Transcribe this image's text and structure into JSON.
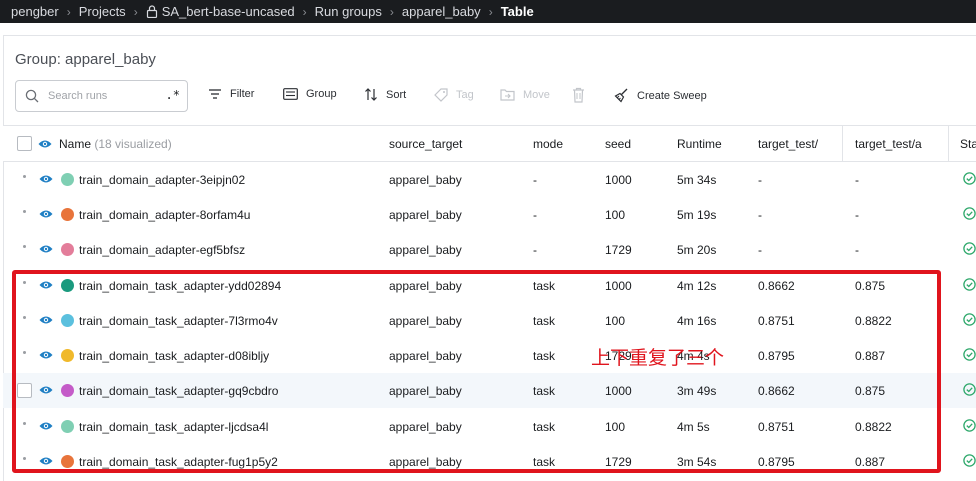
{
  "breadcrumb": {
    "user": "pengber",
    "projects": "Projects",
    "project": "SA_bert-base-uncased",
    "run_groups": "Run groups",
    "group": "apparel_baby",
    "view": "Table"
  },
  "group_title": "Group: apparel_baby",
  "search": {
    "placeholder": "Search runs",
    "regex_label": ".*"
  },
  "toolbar": {
    "filter": "Filter",
    "group": "Group",
    "sort": "Sort",
    "tag": "Tag",
    "move": "Move",
    "create_sweep": "Create Sweep"
  },
  "table": {
    "headers": {
      "name": "Name",
      "name_note": "(18 visualized)",
      "source_target": "source_target",
      "mode": "mode",
      "seed": "seed",
      "runtime": "Runtime",
      "target_test_1": "target_test/",
      "target_test_2": "target_test/a",
      "state": "Sta"
    },
    "rows": [
      {
        "name": "train_domain_adapter-3eipjn02",
        "color": "#7fcfb3",
        "source_target": "apparel_baby",
        "mode": "-",
        "seed": "1000",
        "runtime": "5m 34s",
        "t1": "-",
        "t2": "-"
      },
      {
        "name": "train_domain_adapter-8orfam4u",
        "color": "#e8743b",
        "source_target": "apparel_baby",
        "mode": "-",
        "seed": "100",
        "runtime": "5m 19s",
        "t1": "-",
        "t2": "-"
      },
      {
        "name": "train_domain_adapter-egf5bfsz",
        "color": "#e37d9a",
        "source_target": "apparel_baby",
        "mode": "-",
        "seed": "1729",
        "runtime": "5m 20s",
        "t1": "-",
        "t2": "-"
      },
      {
        "name": "train_domain_task_adapter-ydd02894",
        "color": "#1a9a7e",
        "source_target": "apparel_baby",
        "mode": "task",
        "seed": "1000",
        "runtime": "4m 12s",
        "t1": "0.8662",
        "t2": "0.875"
      },
      {
        "name": "train_domain_task_adapter-7l3rmo4v",
        "color": "#5bc0de",
        "source_target": "apparel_baby",
        "mode": "task",
        "seed": "100",
        "runtime": "4m 16s",
        "t1": "0.8751",
        "t2": "0.8822"
      },
      {
        "name": "train_domain_task_adapter-d08ibljy",
        "color": "#f0b92b",
        "source_target": "apparel_baby",
        "mode": "task",
        "seed": "1729",
        "runtime": "4m 4s",
        "t1": "0.8795",
        "t2": "0.887"
      },
      {
        "name": "train_domain_task_adapter-gq9cbdro",
        "color": "#c45bc8",
        "source_target": "apparel_baby",
        "mode": "task",
        "seed": "1000",
        "runtime": "3m 49s",
        "t1": "0.8662",
        "t2": "0.875"
      },
      {
        "name": "train_domain_task_adapter-ljcdsa4l",
        "color": "#7fcfb3",
        "source_target": "apparel_baby",
        "mode": "task",
        "seed": "100",
        "runtime": "4m 5s",
        "t1": "0.8751",
        "t2": "0.8822"
      },
      {
        "name": "train_domain_task_adapter-fug1p5y2",
        "color": "#e8743b",
        "source_target": "apparel_baby",
        "mode": "task",
        "seed": "1729",
        "runtime": "3m 54s",
        "t1": "0.8795",
        "t2": "0.887"
      }
    ]
  },
  "annotation": {
    "text": "上下重复了三个",
    "color": "#e0141d"
  }
}
